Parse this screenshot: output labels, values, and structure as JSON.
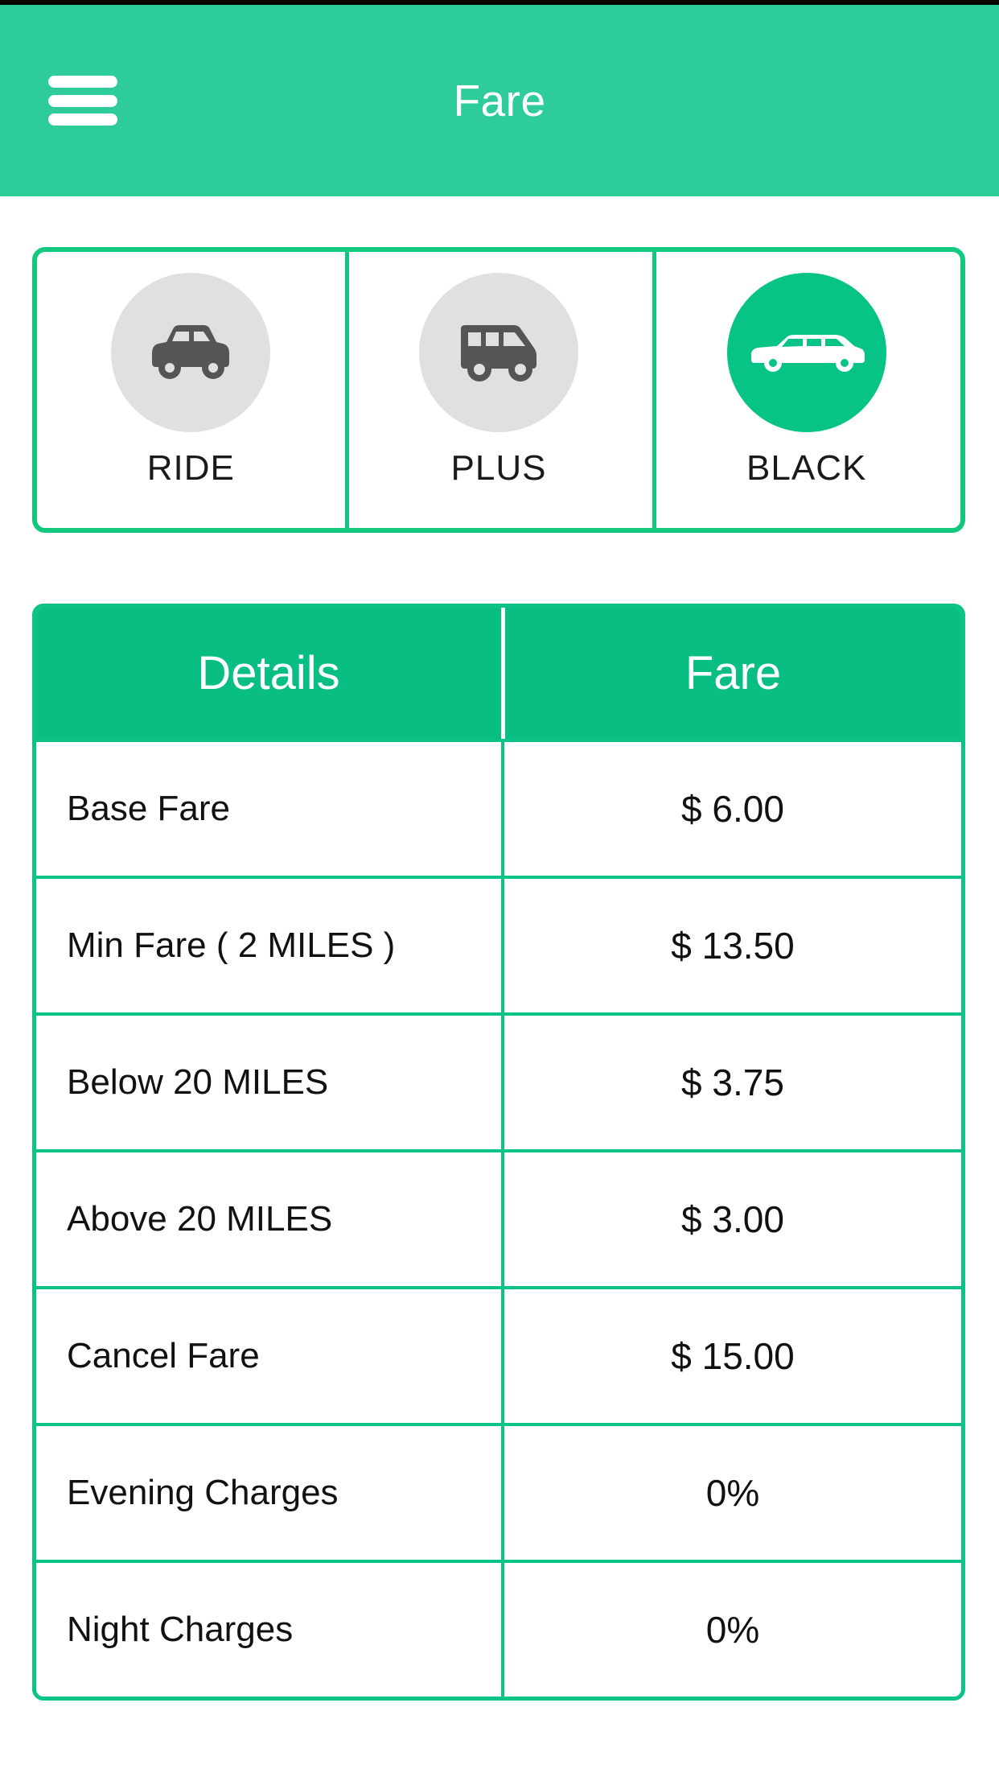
{
  "appbar": {
    "menu_icon": "hamburger-menu-icon",
    "title": "Fare"
  },
  "vehicle_selector": {
    "tabs": [
      {
        "label": "RIDE",
        "icon": "car-icon",
        "selected": false
      },
      {
        "label": "PLUS",
        "icon": "van-icon",
        "selected": false
      },
      {
        "label": "BLACK",
        "icon": "limousine-icon",
        "selected": true
      }
    ]
  },
  "fare_table": {
    "columns": [
      "Details",
      "Fare"
    ],
    "rows": [
      {
        "detail": "Base Fare",
        "fare": "$ 6.00"
      },
      {
        "detail": "Min Fare ( 2 MILES )",
        "fare": "$ 13.50"
      },
      {
        "detail": "Below 20 MILES",
        "fare": "$ 3.75"
      },
      {
        "detail": "Above 20 MILES",
        "fare": "$ 3.00"
      },
      {
        "detail": "Cancel Fare",
        "fare": "$ 15.00"
      },
      {
        "detail": "Evening Charges",
        "fare": "0%"
      },
      {
        "detail": "Night Charges",
        "fare": "0%"
      }
    ]
  },
  "colors": {
    "brand_green": "#2ECC9B",
    "accent_green": "#0BC287",
    "selected_circle": "#07C486",
    "inactive_circle": "#E0E0E0",
    "icon_gray": "#555555",
    "text_dark": "#111111",
    "white": "#FFFFFF"
  }
}
